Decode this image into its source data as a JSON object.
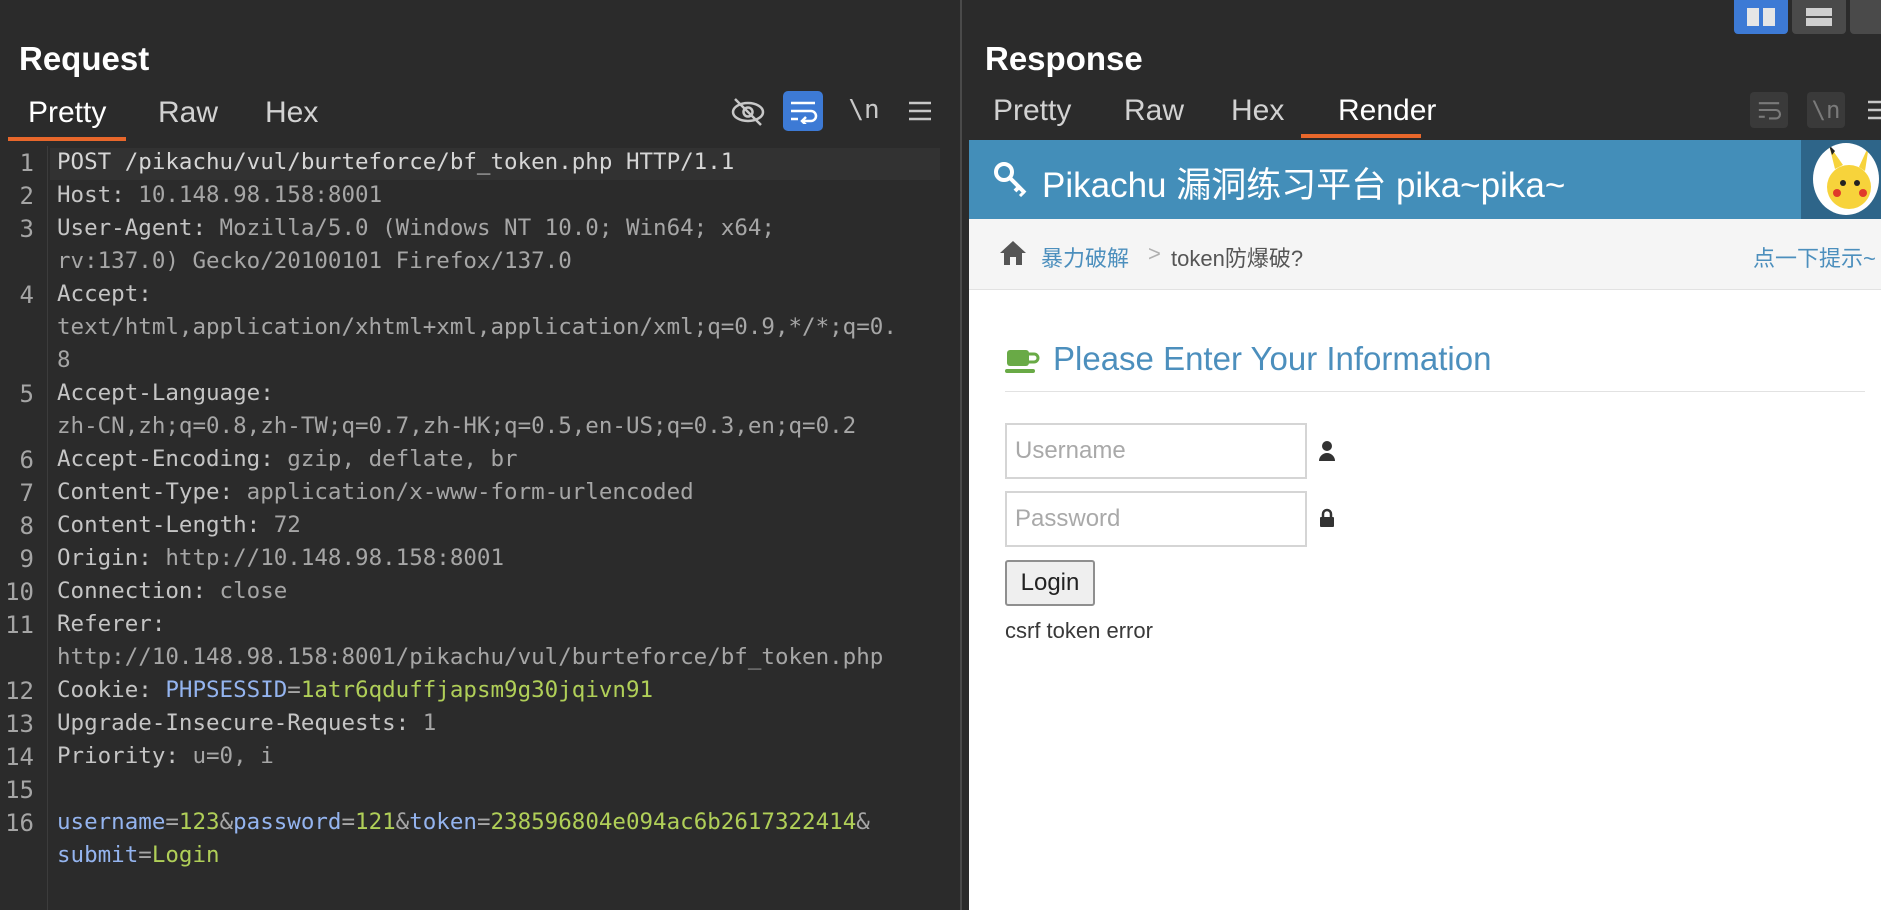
{
  "request": {
    "title": "Request",
    "tabs": [
      "Pretty",
      "Raw",
      "Hex"
    ],
    "active_tab": "Pretty",
    "toolbar_newline_label": "\\n",
    "line_numbers": [
      "1",
      "2",
      "3",
      "4",
      "5",
      "6",
      "7",
      "8",
      "9",
      "10",
      "11",
      "12",
      "13",
      "14",
      "15",
      "16"
    ],
    "lines": {
      "l1": "POST /pikachu/vul/burteforce/bf_token.php HTTP/1.1",
      "l2k": "Host:",
      "l2v": " 10.148.98.158:8001",
      "l3k": "User-Agent:",
      "l3v": " Mozilla/5.0 (Windows NT 10.0; Win64; x64;",
      "l3b": "rv:137.0) Gecko/20100101 Firefox/137.0",
      "l4k": "Accept:",
      "l4b": "text/html,application/xhtml+xml,application/xml;q=0.9,*/*;q=0.",
      "l4c": "8",
      "l5k": "Accept-Language:",
      "l5b": "zh-CN,zh;q=0.8,zh-TW;q=0.7,zh-HK;q=0.5,en-US;q=0.3,en;q=0.2",
      "l6k": "Accept-Encoding:",
      "l6v": " gzip, deflate, br",
      "l7k": "Content-Type:",
      "l7v": " application/x-www-form-urlencoded",
      "l8k": "Content-Length:",
      "l8v": " 72",
      "l9k": "Origin:",
      "l9v": " http://10.148.98.158:8001",
      "l10k": "Connection:",
      "l10v": " close",
      "l11k": "Referer:",
      "l11b": "http://10.148.98.158:8001/pikachu/vul/burteforce/bf_token.php",
      "l12k": "Cookie:",
      "l12n": " PHPSESSID",
      "l12eq": "=",
      "l12val": "1atr6qduffjapsm9g30jqivn91",
      "l13k": "Upgrade-Insecure-Requests:",
      "l13v": " 1",
      "l14k": "Priority:",
      "l14v": " u=0, i",
      "l16_username": "username",
      "l16_eq1": "=",
      "l16_uval": "123",
      "l16_amp1": "&",
      "l16_password": "password",
      "l16_eq2": "=",
      "l16_pval": "121",
      "l16_amp2": "&",
      "l16_token": "token",
      "l16_eq3": "=",
      "l16_tval": "238596804e094ac6b2617322414",
      "l16_amp3": "&",
      "l16_submit": "submit",
      "l16_eq4": "=",
      "l16_sval": "Login"
    }
  },
  "response": {
    "title": "Response",
    "tabs": [
      "Pretty",
      "Raw",
      "Hex",
      "Render"
    ],
    "active_tab": "Render",
    "toolbar_newline_label": "\\n",
    "render": {
      "site_title": "Pikachu 漏洞练习平台 pika~pika~",
      "breadcrumb_section": "暴力破解",
      "breadcrumb_separator": ">",
      "breadcrumb_page": "token防爆破?",
      "hint_link": "点一下提示~",
      "form_title": "Please Enter Your Information",
      "username_placeholder": "Username",
      "password_placeholder": "Password",
      "login_button": "Login",
      "error_message": "csrf token error"
    }
  },
  "colors": {
    "accent_underline": "#e8672b",
    "header_blue": "#438eb9",
    "param_name": "#94b4ef",
    "param_value": "#b0cf58"
  }
}
